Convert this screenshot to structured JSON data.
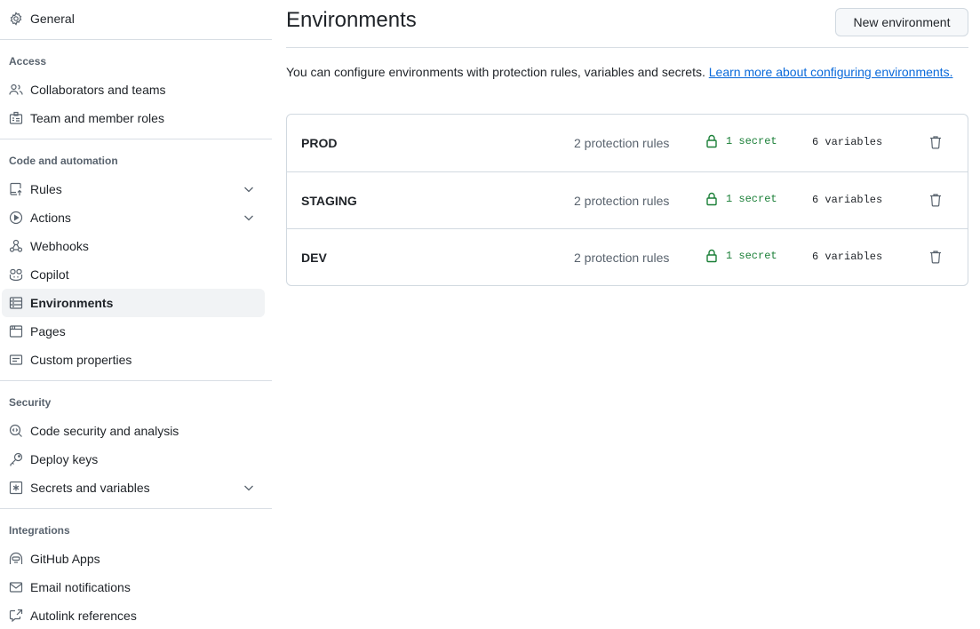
{
  "sidebar": {
    "general": {
      "label": "General",
      "icon": "gear-icon"
    },
    "sections": [
      {
        "heading": "Access",
        "items": [
          {
            "label": "Collaborators and teams",
            "icon": "people-icon"
          },
          {
            "label": "Team and member roles",
            "icon": "id-badge-icon"
          }
        ]
      },
      {
        "heading": "Code and automation",
        "items": [
          {
            "label": "Rules",
            "icon": "repo-push-icon",
            "expandable": true
          },
          {
            "label": "Actions",
            "icon": "play-icon",
            "expandable": true
          },
          {
            "label": "Webhooks",
            "icon": "webhook-icon"
          },
          {
            "label": "Copilot",
            "icon": "copilot-icon"
          },
          {
            "label": "Environments",
            "icon": "server-icon",
            "active": true
          },
          {
            "label": "Pages",
            "icon": "browser-icon"
          },
          {
            "label": "Custom properties",
            "icon": "note-icon"
          }
        ]
      },
      {
        "heading": "Security",
        "items": [
          {
            "label": "Code security and analysis",
            "icon": "codescan-icon"
          },
          {
            "label": "Deploy keys",
            "icon": "key-icon"
          },
          {
            "label": "Secrets and variables",
            "icon": "key-asterisk-icon",
            "expandable": true
          }
        ]
      },
      {
        "heading": "Integrations",
        "items": [
          {
            "label": "GitHub Apps",
            "icon": "hubot-icon"
          },
          {
            "label": "Email notifications",
            "icon": "mail-icon"
          },
          {
            "label": "Autolink references",
            "icon": "cross-reference-icon"
          }
        ]
      }
    ]
  },
  "main": {
    "title": "Environments",
    "new_button": "New environment",
    "intro_text": "You can configure environments with protection rules, variables and secrets. ",
    "intro_link": "Learn more about configuring environments.",
    "environments": [
      {
        "name": "PROD",
        "rules": "2 protection rules",
        "secrets": "1 secret",
        "variables": "6 variables"
      },
      {
        "name": "STAGING",
        "rules": "2 protection rules",
        "secrets": "1 secret",
        "variables": "6 variables"
      },
      {
        "name": "DEV",
        "rules": "2 protection rules",
        "secrets": "1 secret",
        "variables": "6 variables"
      }
    ]
  },
  "colors": {
    "accent_link": "#0969da",
    "secret_green": "#1a7f37",
    "muted_text": "#59636e",
    "border": "#d1d9e0"
  }
}
